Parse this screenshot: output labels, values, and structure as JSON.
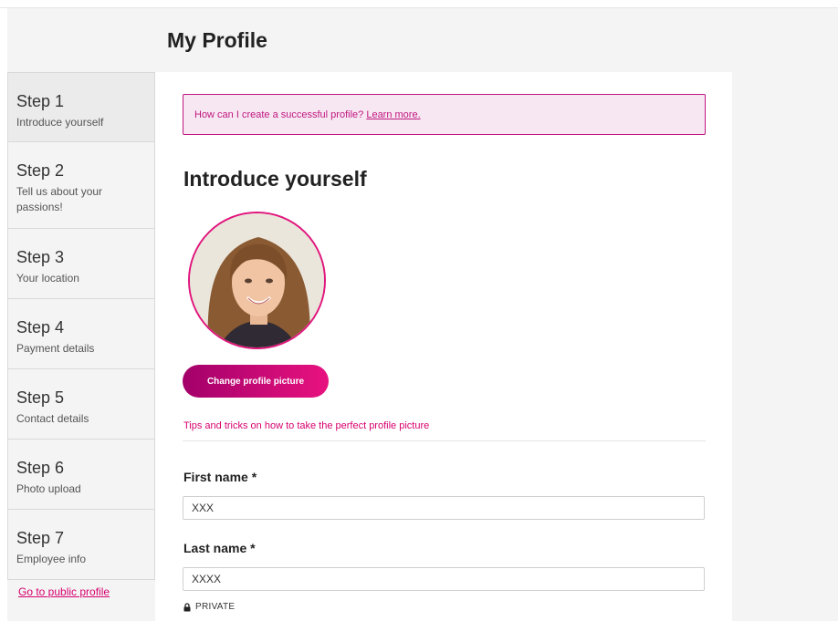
{
  "header": {
    "title": "My Profile"
  },
  "sidebar": {
    "steps": [
      {
        "title": "Step 1",
        "subtitle": "Introduce yourself"
      },
      {
        "title": "Step 2",
        "subtitle": "Tell us about your passions!"
      },
      {
        "title": "Step 3",
        "subtitle": "Your location"
      },
      {
        "title": "Step 4",
        "subtitle": "Payment details"
      },
      {
        "title": "Step 5",
        "subtitle": "Contact details"
      },
      {
        "title": "Step 6",
        "subtitle": "Photo upload"
      },
      {
        "title": "Step 7",
        "subtitle": "Employee info"
      }
    ],
    "public_profile_link": "Go to public profile"
  },
  "main": {
    "notice": {
      "text": "How can I create a successful profile?",
      "link": "Learn more."
    },
    "section_title": "Introduce yourself",
    "change_picture_label": "Change profile picture",
    "tips_link": "Tips and tricks on how to take the perfect profile picture",
    "first_name": {
      "label": "First name *",
      "value": "XXX"
    },
    "last_name": {
      "label": "Last name *",
      "value": "XXXX"
    },
    "privacy_label": "PRIVATE"
  },
  "colors": {
    "accent": "#d6006e",
    "accent_dark": "#a3006a",
    "notice_bg": "#f7e7f3",
    "page_bg": "#f4f4f4"
  },
  "icons": {
    "privacy": "lock-icon"
  }
}
